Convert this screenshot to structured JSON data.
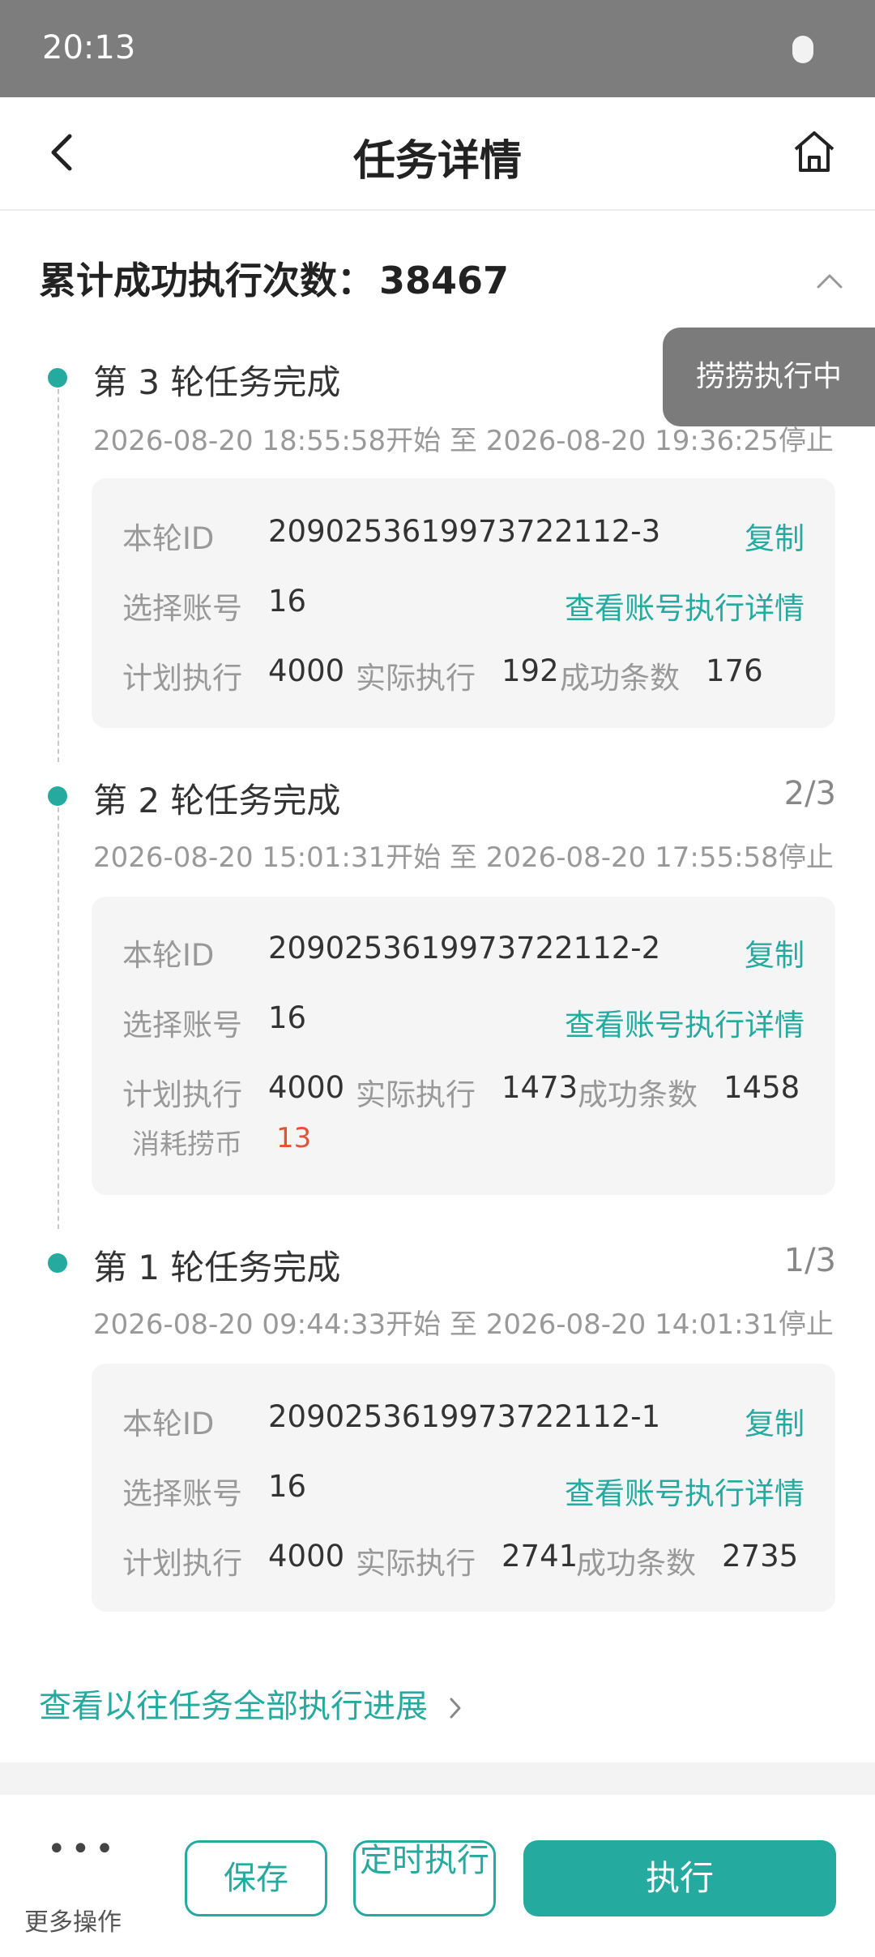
{
  "status_bar": {
    "time": "20:13"
  },
  "header": {
    "title": "任务详情"
  },
  "summary": {
    "label": "累计成功执行次数：",
    "count": "38467"
  },
  "tooltip": "捞捞执行中",
  "rounds": [
    {
      "title": "第 3 轮任务完成",
      "progress": "",
      "time_range": "2026-08-20 18:55:58开始 至 2026-08-20 19:36:25停止",
      "round_id_label": "本轮ID",
      "round_id": "20902536199737221​12-3",
      "copy_label": "复制",
      "account_label": "选择账号",
      "account_value": "16",
      "account_detail_link": "查看账号执行详情",
      "plan_label": "计划执行",
      "plan_value": "4000",
      "actual_label": "实际执行",
      "actual_value": "192",
      "success_label": "成功条数",
      "success_value": "176"
    },
    {
      "title": "第 2 轮任务完成",
      "progress": "2/3",
      "time_range": "2026-08-20 15:01:31开始 至 2026-08-20 17:55:58停止",
      "round_id_label": "本轮ID",
      "round_id": "2090253619973722112-2",
      "copy_label": "复制",
      "account_label": "选择账号",
      "account_value": "16",
      "account_detail_link": "查看账号执行详情",
      "plan_label": "计划执行",
      "plan_value": "4000",
      "actual_label": "实际执行",
      "actual_value": "1473",
      "success_label": "成功条数",
      "success_value": "1458",
      "cost_label": "消耗捞币",
      "cost_value": "13"
    },
    {
      "title": "第 1 轮任务完成",
      "progress": "1/3",
      "time_range": "2026-08-20 09:44:33开始 至 2026-08-20 14:01:31停止",
      "round_id_label": "本轮ID",
      "round_id": "2090253619973722112-1",
      "copy_label": "复制",
      "account_label": "选择账号",
      "account_value": "16",
      "account_detail_link": "查看账号执行详情",
      "plan_label": "计划执行",
      "plan_value": "4000",
      "actual_label": "实际执行",
      "actual_value": "2741",
      "success_label": "成功条数",
      "success_value": "2735"
    }
  ],
  "history_link": "查看以往任务全部执行进展",
  "bottom": {
    "more_label": "更多操作",
    "save_label": "保存",
    "timed_label": "定时执行",
    "run_label": "执行"
  },
  "colors": {
    "accent": "#25aaa0",
    "cost": "#e0533b"
  }
}
